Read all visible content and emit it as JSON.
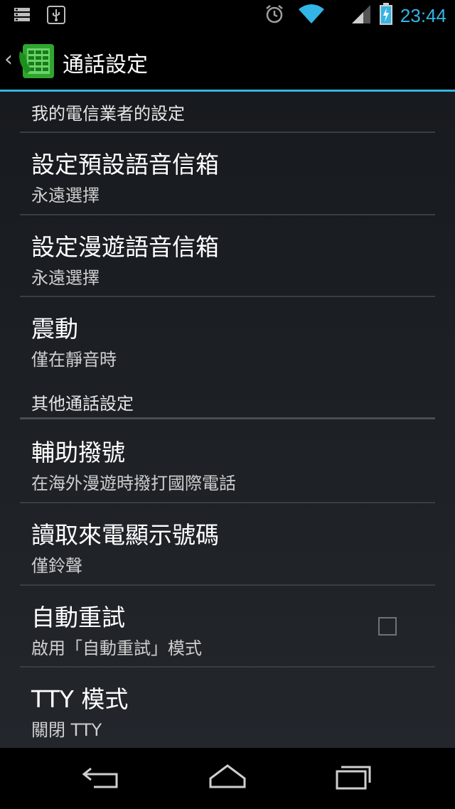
{
  "status_bar": {
    "time": "23:44",
    "icons": [
      "sd-card-icon",
      "usb-icon",
      "alarm-icon",
      "wifi-icon",
      "signal-icon",
      "battery-charging-icon"
    ],
    "accent_color": "#33b5e5"
  },
  "action_bar": {
    "title": "通話設定",
    "app_icon": "phone-settings-icon"
  },
  "sections": [
    {
      "header": "我的電信業者的設定"
    },
    {
      "header": "其他通話設定"
    }
  ],
  "preferences": [
    {
      "title": "設定預設語音信箱",
      "summary": "永遠選擇"
    },
    {
      "title": "設定漫遊語音信箱",
      "summary": "永遠選擇"
    },
    {
      "title": "震動",
      "summary": "僅在靜音時"
    },
    {
      "title": "輔助撥號",
      "summary": "在海外漫遊時撥打國際電話"
    },
    {
      "title": "讀取來電顯示號碼",
      "summary": "僅鈴聲"
    },
    {
      "title": "自動重試",
      "summary": "啟用「自動重試」模式",
      "checked": false
    },
    {
      "title": "TTY 模式",
      "summary": "關閉 TTY"
    }
  ],
  "nav_bar": {
    "buttons": [
      "back-icon",
      "home-icon",
      "recent-apps-icon"
    ]
  }
}
